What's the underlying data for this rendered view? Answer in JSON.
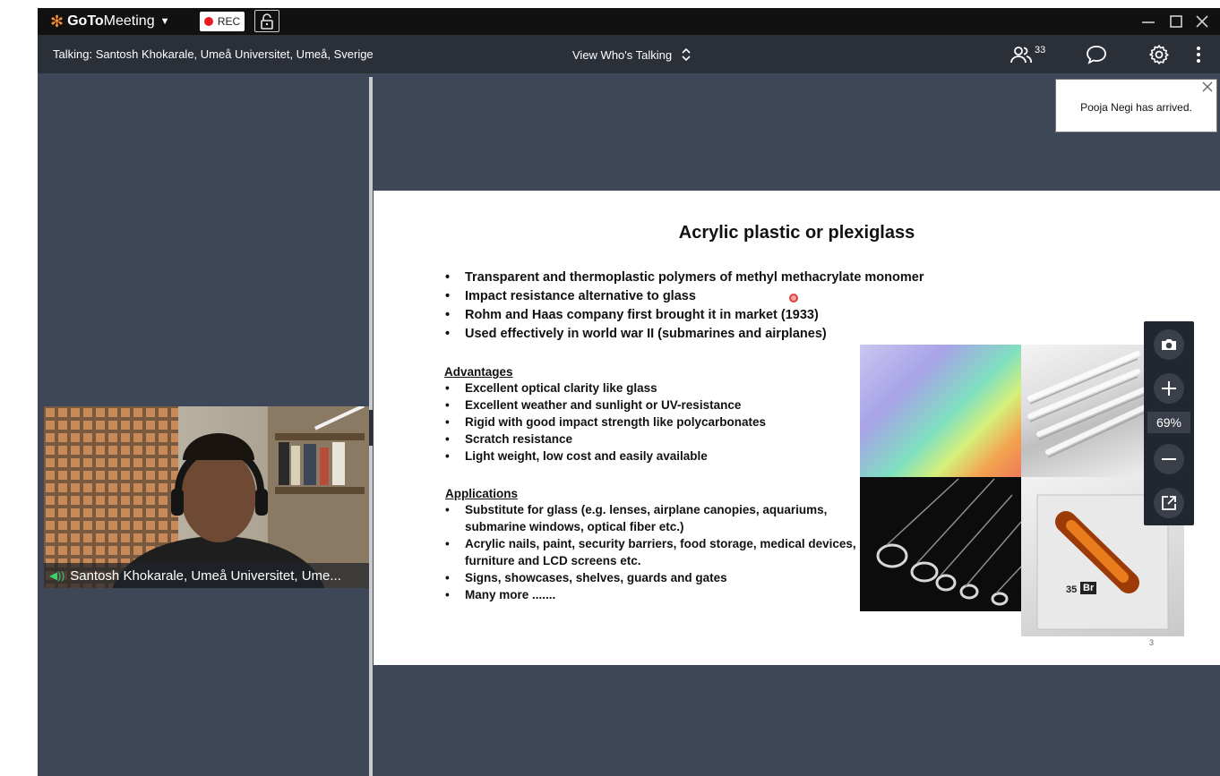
{
  "app": {
    "brand": {
      "part1": "GoTo",
      "part2": "Meeting"
    },
    "rec_label": "REC"
  },
  "toolbar": {
    "talking": "Talking: Santosh Khokarale, Umeå Universitet, Umeå, Sverige",
    "view_whos_talking": "View Who's Talking",
    "attendee_count": "33"
  },
  "video": {
    "participant_name": "Santosh Khokarale, Umeå Universitet, Ume..."
  },
  "slide": {
    "title": "Acrylic plastic or plexiglass",
    "bullets": [
      "Transparent and thermoplastic polymers of methyl methacrylate monomer",
      "Impact resistance alternative to glass",
      "Rohm and Haas company first brought it in market (1933)",
      "Used effectively in world war II (submarines and airplanes)"
    ],
    "advantages_heading": "Advantages",
    "advantages": [
      "Excellent optical clarity like glass",
      "Excellent weather and sunlight or UV-resistance",
      "Rigid with good impact strength like polycarbonates",
      "Scratch resistance",
      "Light weight, low cost and easily available"
    ],
    "applications_heading": "Applications",
    "applications": [
      "Substitute for glass (e.g. lenses, airplane canopies, aquariums,",
      "submarine windows, optical fiber etc.)",
      "Acrylic nails, paint, security barriers, food storage, medical devices,",
      "furniture and LCD screens etc.",
      "Signs, showcases, shelves, guards and gates",
      "Many more ......."
    ],
    "cube_label_1": "35",
    "cube_label_2": "Br",
    "page_number": "3"
  },
  "zoom": {
    "percent": "69%"
  },
  "notification": {
    "message": "Pooja Negi has arrived."
  }
}
